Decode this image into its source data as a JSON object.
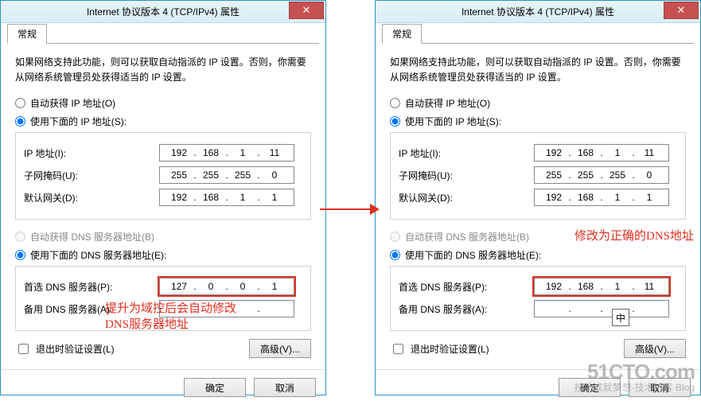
{
  "dialogs": [
    {
      "title": "Internet 协议版本 4 (TCP/IPv4) 属性",
      "tab": "常规",
      "description": "如果网络支持此功能，则可以获取自动指派的 IP 设置。否则，你需要从网络系统管理员处获得适当的 IP 设置。",
      "radio_auto_ip": "自动获得 IP 地址(O)",
      "radio_manual_ip": "使用下面的 IP 地址(S):",
      "ip_label": "IP 地址(I):",
      "ip_value": [
        "192",
        "168",
        "1",
        "11"
      ],
      "mask_label": "子网掩码(U):",
      "mask_value": [
        "255",
        "255",
        "255",
        "0"
      ],
      "gw_label": "默认网关(D):",
      "gw_value": [
        "192",
        "168",
        "1",
        "1"
      ],
      "radio_auto_dns": "自动获得 DNS 服务器地址(B)",
      "radio_manual_dns": "使用下面的 DNS 服务器地址(E):",
      "dns1_label": "首选 DNS 服务器(P):",
      "dns1_value": [
        "127",
        "0",
        "0",
        "1"
      ],
      "dns2_label": "备用 DNS 服务器(A):",
      "dns2_value": [
        "",
        "",
        "",
        ""
      ],
      "chk_exit_validate": "退出时验证设置(L)",
      "btn_advanced": "高级(V)...",
      "btn_ok": "确定",
      "btn_cancel": "取消"
    },
    {
      "title": "Internet 协议版本 4 (TCP/IPv4) 属性",
      "tab": "常规",
      "description": "如果网络支持此功能，则可以获取自动指派的 IP 设置。否则，你需要从网络系统管理员处获得适当的 IP 设置。",
      "radio_auto_ip": "自动获得 IP 地址(O)",
      "radio_manual_ip": "使用下面的 IP 地址(S):",
      "ip_label": "IP 地址(I):",
      "ip_value": [
        "192",
        "168",
        "1",
        "11"
      ],
      "mask_label": "子网掩码(U):",
      "mask_value": [
        "255",
        "255",
        "255",
        "0"
      ],
      "gw_label": "默认网关(D):",
      "gw_value": [
        "192",
        "168",
        "1",
        "1"
      ],
      "radio_auto_dns": "自动获得 DNS 服务器地址(B)",
      "radio_manual_dns": "使用下面的 DNS 服务器地址(E):",
      "dns1_label": "首选 DNS 服务器(P):",
      "dns1_value": [
        "192",
        "168",
        "1",
        "11"
      ],
      "dns2_label": "备用 DNS 服务器(A):",
      "dns2_value": [
        "",
        "",
        "",
        ""
      ],
      "chk_exit_validate": "退出时验证设置(L)",
      "btn_advanced": "高级(V)...",
      "btn_ok": "确定",
      "btn_cancel": "取消"
    }
  ],
  "annot_left": "提升为域控后会自动修改\nDNS服务器地址",
  "annot_right": "修改为正确的DNS地址",
  "ime": "中",
  "watermark_big": "51CTO.com",
  "watermark_small": "技术成就梦想·技术博客 Blog"
}
